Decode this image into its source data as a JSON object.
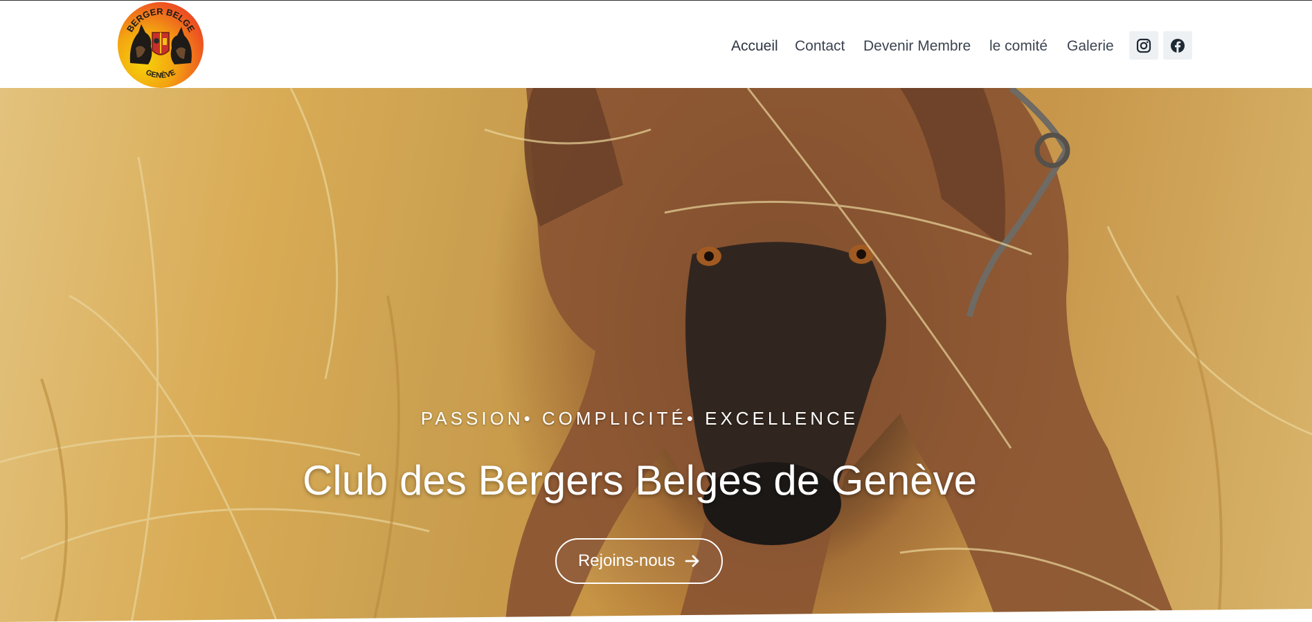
{
  "logo": {
    "top_text": "BERGER BELGE",
    "bottom_text": "GENÈVE"
  },
  "nav": {
    "items": [
      {
        "label": "Accueil",
        "active": true
      },
      {
        "label": "Contact"
      },
      {
        "label": "Devenir Membre"
      },
      {
        "label": "le comité"
      },
      {
        "label": "Galerie"
      }
    ],
    "social": [
      "instagram-icon",
      "facebook-icon"
    ]
  },
  "hero": {
    "tagline": "PASSION• COMPLICITÉ• EXCELLENCE",
    "title": "Club des Bergers Belges de Genève",
    "cta_label": "Rejoins-nous"
  },
  "colors": {
    "nav_text": "#3b4450",
    "social_bg": "#eef1f4",
    "hero_gold": "#d9ab55",
    "dog_brown": "#8a5532"
  }
}
